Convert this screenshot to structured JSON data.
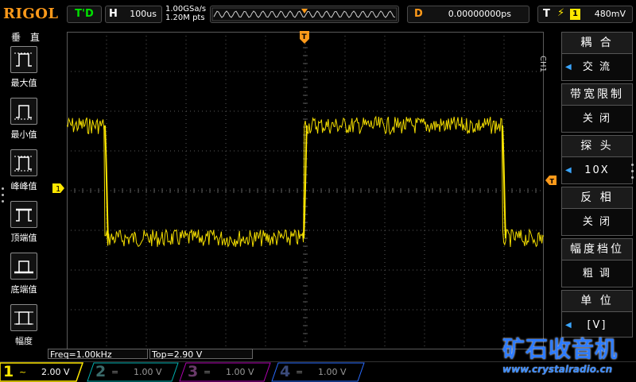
{
  "header": {
    "brand": "RIGOL",
    "run_state": "T'D",
    "timebase_key": "H",
    "timebase_value": "100us",
    "sample_rate": "1.00GSa/s",
    "memory_depth": "1.20M pts",
    "delay_key": "D",
    "delay_value": "0.00000000ps",
    "trigger_key": "T",
    "trigger_channel": "1",
    "trigger_level": "480mV"
  },
  "left_panel": {
    "title": "垂 直",
    "items": [
      {
        "label": "最大值",
        "icon": "max-value-icon"
      },
      {
        "label": "最小值",
        "icon": "min-value-icon"
      },
      {
        "label": "峰峰值",
        "icon": "peak-to-peak-icon"
      },
      {
        "label": "顶端值",
        "icon": "top-value-icon"
      },
      {
        "label": "底端值",
        "icon": "base-value-icon"
      },
      {
        "label": "幅度",
        "icon": "amplitude-icon"
      }
    ]
  },
  "right_panel": {
    "channel_label": "CH1",
    "items": [
      {
        "title": "耦 合",
        "value": "交 流"
      },
      {
        "title": "带宽限制",
        "value": "关 闭"
      },
      {
        "title": "探 头",
        "value": "10X"
      },
      {
        "title": "反 相",
        "value": "关 闭"
      },
      {
        "title": "幅度档位",
        "value": "粗 调"
      },
      {
        "title": "单 位",
        "value": "[V]"
      }
    ]
  },
  "measurements": {
    "freq": "Freq=1.00kHz",
    "top": "Top=2.90 V"
  },
  "channels": [
    {
      "num": "1",
      "coupling": "~",
      "scale": "2.00 V",
      "color": "#ffe800"
    },
    {
      "num": "2",
      "coupling": "=",
      "scale": "1.00 V",
      "color": "#00b0b0"
    },
    {
      "num": "3",
      "coupling": "=",
      "scale": "1.00 V",
      "color": "#d000d0"
    },
    {
      "num": "4",
      "coupling": "=",
      "scale": "1.00 V",
      "color": "#2a6cff"
    }
  ],
  "markers": {
    "ch1_marker": "1",
    "trigger_marker": "T"
  },
  "watermark": {
    "title": "矿石收音机",
    "url": "www.crystalradio.cn"
  },
  "colors": {
    "trace": "#ffe800",
    "accent": "#ff9a1a",
    "grid": "#5a5a5a"
  }
}
